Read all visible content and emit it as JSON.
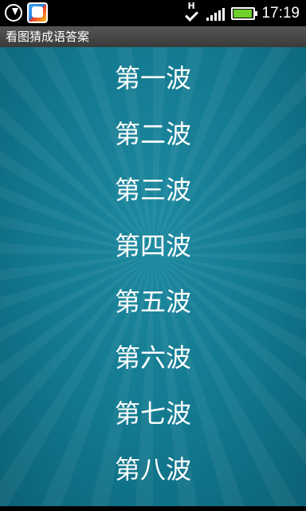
{
  "status_bar": {
    "time": "17:19",
    "network_type": "H",
    "icons": [
      "download-icon",
      "app-notification-icon",
      "network-icon",
      "signal-icon",
      "battery-icon"
    ],
    "battery_color": "#6fd02c"
  },
  "app": {
    "title": "看图猜成语答案"
  },
  "waves": [
    {
      "label": "第一波"
    },
    {
      "label": "第二波"
    },
    {
      "label": "第三波"
    },
    {
      "label": "第四波"
    },
    {
      "label": "第五波"
    },
    {
      "label": "第六波"
    },
    {
      "label": "第七波"
    },
    {
      "label": "第八波"
    }
  ],
  "colors": {
    "background": "#12788e",
    "text": "#ffffff",
    "title_bar": "#454545"
  }
}
